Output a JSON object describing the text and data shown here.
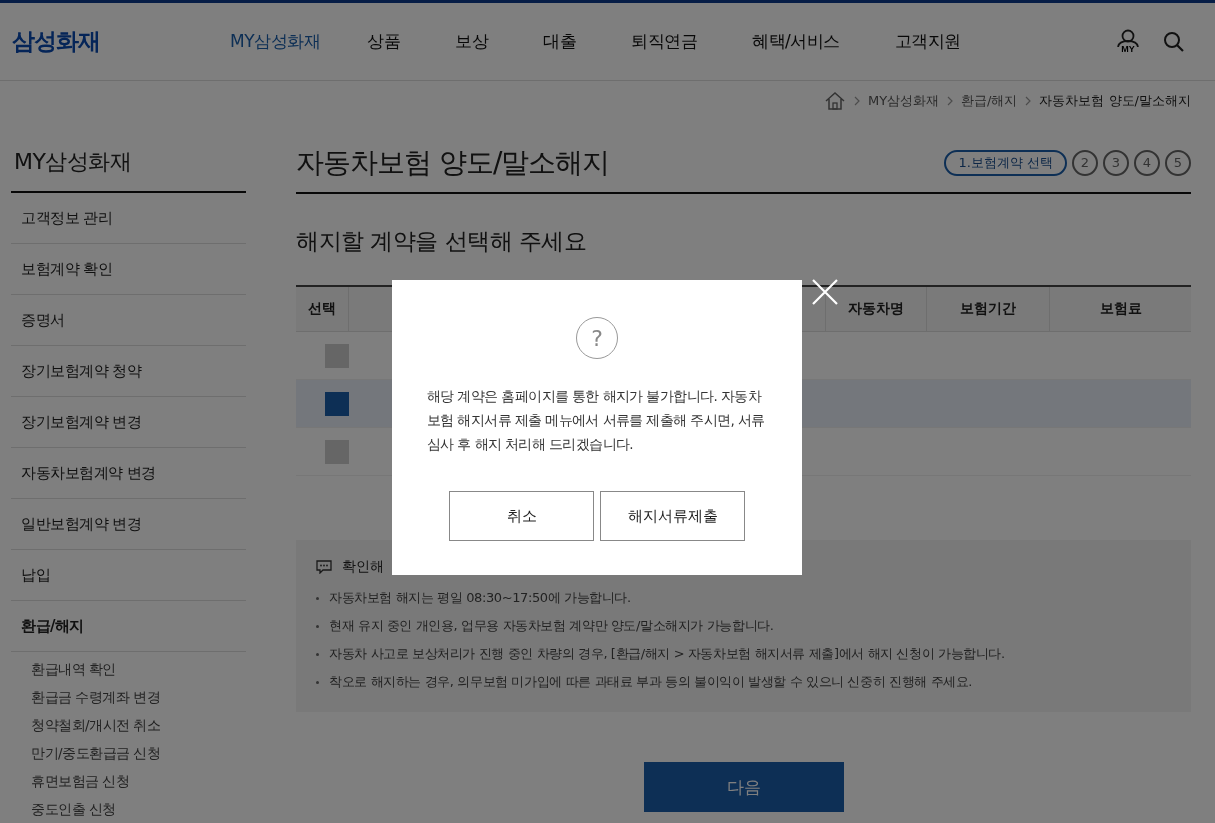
{
  "logo": "삼성화재",
  "nav": [
    {
      "label": "MY삼성화재",
      "selected": true
    },
    {
      "label": "상품",
      "selected": false
    },
    {
      "label": "보상",
      "selected": false
    },
    {
      "label": "대출",
      "selected": false
    },
    {
      "label": "퇴직연금",
      "selected": false
    },
    {
      "label": "혜택/서비스",
      "selected": false
    },
    {
      "label": "고객지원",
      "selected": false
    }
  ],
  "my_badge": "MY",
  "breadcrumb": [
    "MY삼성화재",
    "환급/해지",
    "자동차보험 양도/말소해지"
  ],
  "sidebar": {
    "title": "MY삼성화재",
    "items": [
      {
        "label": "고객정보 관리",
        "selected": false
      },
      {
        "label": "보험계약 확인",
        "selected": false
      },
      {
        "label": "증명서",
        "selected": false
      },
      {
        "label": "장기보험계약 청약",
        "selected": false
      },
      {
        "label": "장기보험계약 변경",
        "selected": false
      },
      {
        "label": "자동차보험계약 변경",
        "selected": false
      },
      {
        "label": "일반보험계약 변경",
        "selected": false
      },
      {
        "label": "납입",
        "selected": false
      },
      {
        "label": "환급/해지",
        "selected": true,
        "children": [
          {
            "label": "환급내역 확인"
          },
          {
            "label": "환급금 수령계좌 변경"
          },
          {
            "label": "청약철회/개시전 취소"
          },
          {
            "label": "만기/중도환급금 신청"
          },
          {
            "label": "휴면보험금 신청"
          },
          {
            "label": "중도인출 신청"
          }
        ]
      }
    ]
  },
  "page_title": "자동차보험 양도/말소해지",
  "steps": [
    {
      "label": "1.보험계약 선택",
      "selected": true
    },
    {
      "label": "2",
      "selected": false
    },
    {
      "label": "3",
      "selected": false
    },
    {
      "label": "4",
      "selected": false
    },
    {
      "label": "5",
      "selected": false
    }
  ],
  "subtitle": "해지할 계약을 선택해 주세요",
  "table": {
    "columns": [
      "선택",
      "자동차명",
      "보험기간",
      "보험료"
    ],
    "rows": [
      {
        "selected": false
      },
      {
        "selected": true
      },
      {
        "selected": false
      }
    ]
  },
  "notice": {
    "heading": "확인해",
    "items": [
      "자동차보험 해지는 평일 08:30~17:50에 가능합니다.",
      "현재 유지 중인 개인용, 업무용 자동차보험 계약만 양도/말소해지가 가능합니다.",
      "자동차 사고로 보상처리가 진행 중인 차량의 경우, [환급/해지 > 자동차보험 해지서류 제출]에서 해지 신청이 가능합니다.",
      "착오로 해지하는 경우, 의무보험 미가입에 따른 과태료 부과 등의 불이익이 발생할 수 있으니 신중히 진행해 주세요."
    ]
  },
  "next_button": "다음",
  "modal": {
    "icon": "?",
    "message": "해당 계약은 홈페이지를 통한 해지가 불가합니다. 자동차보험 해지서류 제출 메뉴에서 서류를 제출해 주시면, 서류심사 후 해지 처리해 드리겠습니다.",
    "buttons": [
      "취소",
      "해지서류제출"
    ]
  }
}
